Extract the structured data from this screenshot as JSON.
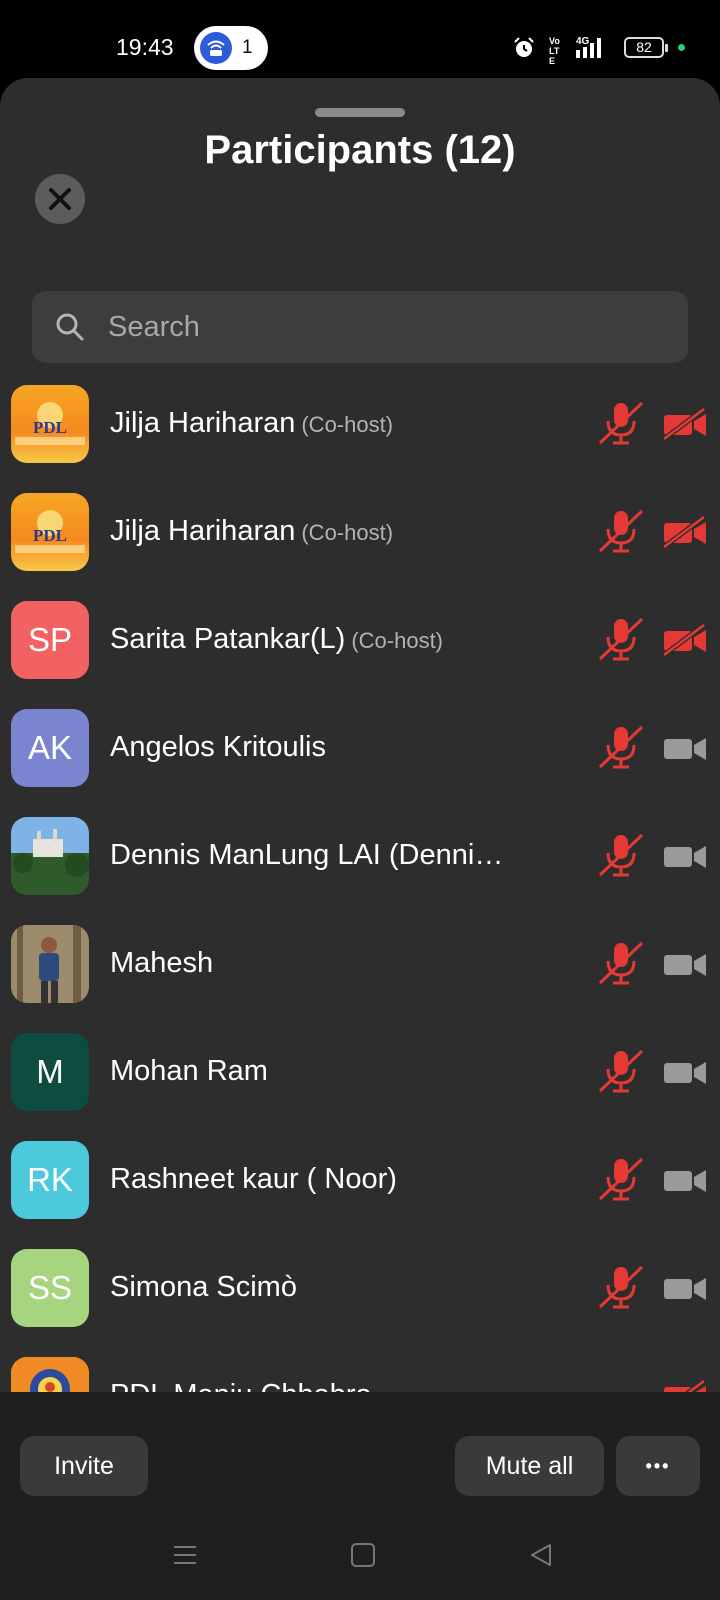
{
  "status_bar": {
    "time": "19:43",
    "hotspot_count": "1",
    "network": "4G",
    "volte": "Vo LTE",
    "battery": "82",
    "icons": [
      "hotspot-icon",
      "alarm-icon",
      "signal-icon",
      "battery-icon"
    ]
  },
  "sheet": {
    "title": "Participants (12)",
    "search_placeholder": "Search"
  },
  "participants": [
    {
      "name": "Jilja Hariharan",
      "role": "(Co-host)",
      "avatar_type": "logo",
      "avatar_text": "PDL",
      "mic": "muted",
      "camera": "off"
    },
    {
      "name": "Jilja Hariharan",
      "role": "(Co-host)",
      "avatar_type": "logo",
      "avatar_text": "PDL",
      "mic": "muted",
      "camera": "off"
    },
    {
      "name": "Sarita Patankar(L)",
      "role": "(Co-host)",
      "avatar_type": "initials",
      "avatar_text": "SP",
      "avatar_color": "#f26262",
      "mic": "muted",
      "camera": "off"
    },
    {
      "name": "Angelos Kritoulis",
      "role": "",
      "avatar_type": "initials",
      "avatar_text": "AK",
      "avatar_color": "#7b84cf",
      "mic": "muted",
      "camera": "on"
    },
    {
      "name": "Dennis ManLung LAI (Denni…",
      "role": "",
      "avatar_type": "photo-castle",
      "avatar_text": "",
      "mic": "muted",
      "camera": "on"
    },
    {
      "name": "Mahesh",
      "role": "",
      "avatar_type": "photo-person",
      "avatar_text": "",
      "mic": "muted",
      "camera": "on"
    },
    {
      "name": "Mohan Ram",
      "role": "",
      "avatar_type": "initials",
      "avatar_text": "M",
      "avatar_color": "#0d4d40",
      "mic": "muted",
      "camera": "on"
    },
    {
      "name": "Rashneet kaur ( Noor)",
      "role": "",
      "avatar_type": "initials",
      "avatar_text": "RK",
      "avatar_color": "#4ccadb",
      "mic": "muted",
      "camera": "on"
    },
    {
      "name": "Simona Scimò",
      "role": "",
      "avatar_type": "initials",
      "avatar_text": "SS",
      "avatar_color": "#a7d47e",
      "mic": "muted",
      "camera": "on"
    },
    {
      "name": "PDL Manju Chhabra",
      "role": "",
      "avatar_type": "logo-round",
      "avatar_text": "",
      "mic": "none",
      "camera": "off"
    }
  ],
  "actions": {
    "invite": "Invite",
    "mute_all": "Mute all",
    "more": "•••"
  },
  "colors": {
    "muted_red": "#e53935",
    "sheet_bg": "#2d2d2d",
    "camera_on": "#9a9a9a"
  }
}
